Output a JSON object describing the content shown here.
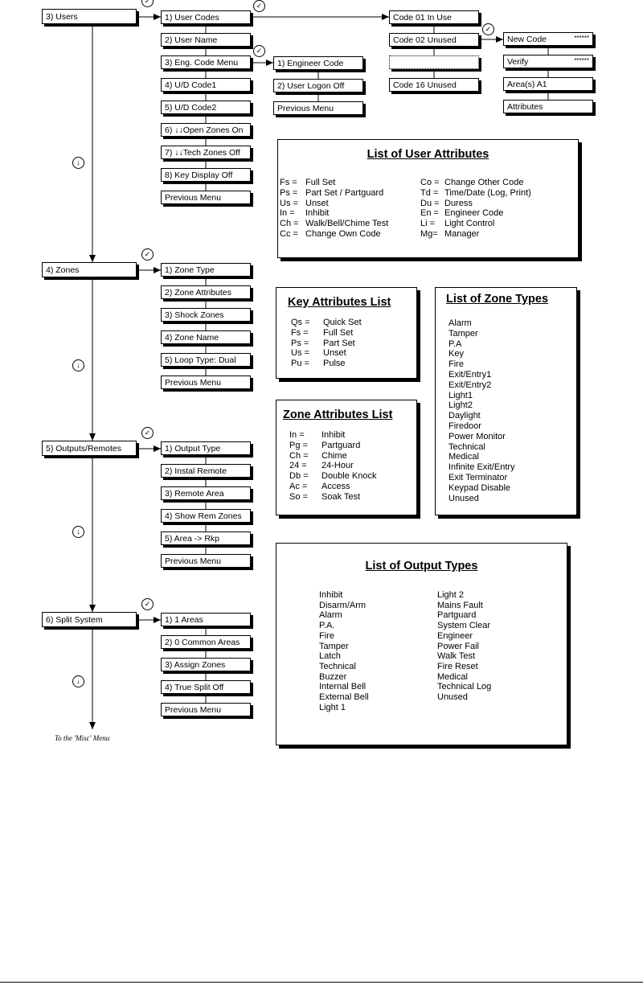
{
  "main_menu": [
    {
      "label": "3) Users"
    },
    {
      "label": "4) Zones"
    },
    {
      "label": "5) Outputs/Remotes"
    },
    {
      "label": "6) Split System"
    }
  ],
  "users_submenu": [
    "1) User Codes",
    "2) User Name",
    "3) Eng. Code Menu",
    "4) U/D Code1",
    "5) U/D Code2",
    "6) ↓↓Open Zones On",
    "7) ↓↓Tech Zones Off",
    "8) Key Display Off",
    "Previous Menu"
  ],
  "eng_submenu": [
    "1) Engineer Code",
    "2) User Logon Off",
    "Previous Menu"
  ],
  "user_codes": [
    "Code 01 In Use",
    "Code 02 Unused",
    "",
    "Code 16 Unused"
  ],
  "code_options": [
    {
      "label": "New Code",
      "value": "******"
    },
    {
      "label": "Verify",
      "value": "******"
    },
    {
      "label": "Area(s) A1"
    },
    {
      "label": "Attributes"
    }
  ],
  "zones_submenu": [
    "1) Zone Type",
    "2) Zone Attributes",
    "3) Shock Zones",
    "4) Zone Name",
    "5) Loop Type: Dual",
    "Previous Menu"
  ],
  "outputs_submenu": [
    "1) Output Type",
    "2) Instal Remote",
    "3) Remote Area",
    "4) Show Rem Zones",
    "5) Area -> Rkp",
    "Previous Menu"
  ],
  "split_submenu": [
    "1) 1 Areas",
    "2) 0 Common Areas",
    "3) Assign Zones",
    "4) True Split Off",
    "Previous Menu"
  ],
  "footer_note": "To the 'Misc' Menu",
  "user_attributes": {
    "title": "List of User Attributes",
    "left": [
      [
        "Fs =",
        "Full Set"
      ],
      [
        "Ps =",
        "Part Set / Partguard"
      ],
      [
        "Us =",
        "Unset"
      ],
      [
        "In =",
        "Inhibit"
      ],
      [
        "Ch =",
        "Walk/Bell/Chime Test"
      ],
      [
        "Cc =",
        "Change Own Code"
      ]
    ],
    "right": [
      [
        "Co =",
        "Change Other Code"
      ],
      [
        "Td =",
        "Time/Date (Log, Print)"
      ],
      [
        "Du =",
        "Duress"
      ],
      [
        "En =",
        "Engineer Code"
      ],
      [
        "Li =",
        "Light Control"
      ],
      [
        "Mg=",
        "Manager"
      ]
    ]
  },
  "key_attributes": {
    "title": "Key Attributes List",
    "items": [
      [
        "Qs =",
        "Quick Set"
      ],
      [
        "Fs =",
        "Full Set"
      ],
      [
        "Ps =",
        "Part Set"
      ],
      [
        "Us =",
        "Unset"
      ],
      [
        "Pu =",
        "Pulse"
      ]
    ]
  },
  "zone_attributes": {
    "title": "Zone Attributes List",
    "items": [
      [
        "In =",
        "Inhibit"
      ],
      [
        "Pg =",
        "Partguard"
      ],
      [
        "Ch =",
        "Chime"
      ],
      [
        "24 =",
        "24-Hour"
      ],
      [
        "Db =",
        "Double Knock"
      ],
      [
        "Ac =",
        "Access"
      ],
      [
        "So =",
        "Soak Test"
      ]
    ]
  },
  "zone_types": {
    "title": "List of Zone Types",
    "items": [
      "Alarm",
      "Tamper",
      "P.A",
      "Key",
      "Fire",
      "Exit/Entry1",
      "Exit/Entry2",
      "Light1",
      "Light2",
      "Daylight",
      "Firedoor",
      "Power Monitor",
      "Technical",
      "Medical",
      "Infinite Exit/Entry",
      "Exit Terminator",
      "Keypad Disable",
      "Unused"
    ]
  },
  "output_types": {
    "title": "List of Output Types",
    "left": [
      "Inhibit",
      "Disarm/Arm",
      "Alarm",
      "P.A.",
      "Fire",
      "Tamper",
      "Latch",
      "Technical",
      "Buzzer",
      "Internal Bell",
      "External Bell",
      "Light 1"
    ],
    "right": [
      "Light 2",
      "Mains Fault",
      "Partguard",
      "System Clear",
      "Engineer",
      "Power Fail",
      "Walk Test",
      "Fire Reset",
      "Medical",
      "Technical Log",
      "Unused"
    ]
  },
  "icons": {
    "check": "check-circle-icon",
    "down": "down-arrow-circle-icon"
  }
}
